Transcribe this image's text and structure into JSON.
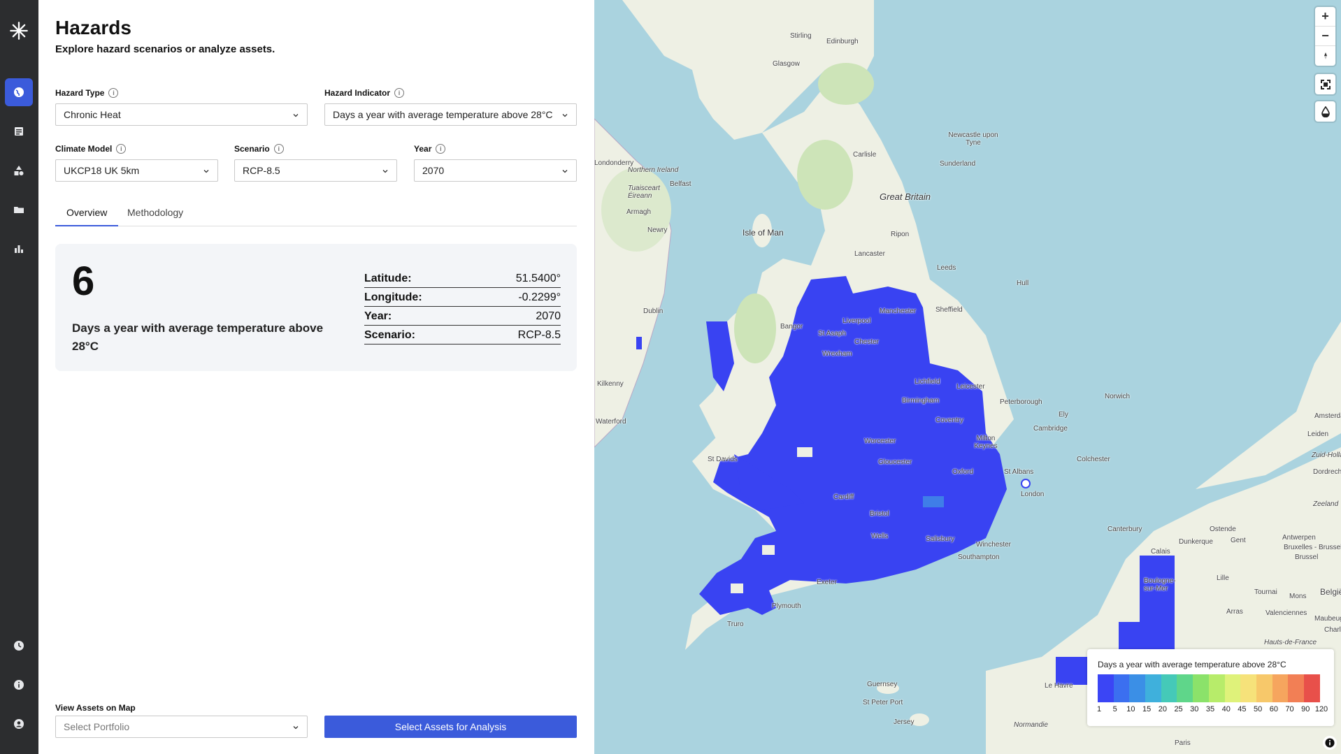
{
  "page": {
    "title": "Hazards",
    "subtitle": "Explore hazard scenarios or analyze assets."
  },
  "sidebar": {
    "items": [
      {
        "icon": "logo-icon"
      },
      {
        "icon": "globe-icon",
        "active": true
      },
      {
        "icon": "list-icon"
      },
      {
        "icon": "shapes-icon"
      },
      {
        "icon": "folder-icon"
      },
      {
        "icon": "bar-chart-icon"
      },
      {
        "icon": "clock-icon"
      },
      {
        "icon": "info-icon"
      },
      {
        "icon": "user-icon"
      }
    ]
  },
  "filters": {
    "hazard_type": {
      "label": "Hazard Type",
      "value": "Chronic Heat"
    },
    "hazard_indicator": {
      "label": "Hazard Indicator",
      "value": "Days a year with average temperature above 28°C"
    },
    "climate_model": {
      "label": "Climate Model",
      "value": "UKCP18 UK 5km"
    },
    "scenario": {
      "label": "Scenario",
      "value": "RCP-8.5"
    },
    "year": {
      "label": "Year",
      "value": "2070"
    }
  },
  "tabs": [
    {
      "label": "Overview",
      "active": true
    },
    {
      "label": "Methodology",
      "active": false
    }
  ],
  "overview": {
    "value": "6",
    "description": "Days a year with average temperature above 28°C",
    "details": [
      {
        "key": "Latitude:",
        "value": "51.5400°"
      },
      {
        "key": "Longitude:",
        "value": "-0.2299°"
      },
      {
        "key": "Year:",
        "value": "2070"
      },
      {
        "key": "Scenario:",
        "value": "RCP-8.5"
      }
    ]
  },
  "assets": {
    "label": "View Assets on Map",
    "placeholder": "Select Portfolio",
    "button": "Select Assets for Analysis"
  },
  "map": {
    "places": [
      "Stirling",
      "Edinburgh",
      "Glasgow",
      "Newcastle upon Tyne",
      "Carlisle",
      "Sunderland",
      "Great Britain",
      "Belfast",
      "Northern Ireland",
      "Tuaisceart Éireann",
      "Armagh",
      "Newry",
      "Isle of Man",
      "Ripon",
      "Lancaster",
      "Leeds",
      "Hull",
      "Manchester",
      "Sheffield",
      "Liverpool",
      "Bangor",
      "St Asaph",
      "Chester",
      "Wrexham",
      "Dublin",
      "Lichfield",
      "Leicester",
      "Birmingham",
      "Peterborough",
      "Norwich",
      "Ely",
      "Coventry",
      "Cambridge",
      "Worcester",
      "Milton Keynes",
      "Gloucester",
      "Oxford",
      "St Albans",
      "Colchester",
      "London",
      "St Davids",
      "Cardiff",
      "Bristol",
      "Wells",
      "Salisbury",
      "Winchester",
      "Canterbury",
      "Southampton",
      "Exeter",
      "Plymouth",
      "Truro",
      "Guernsey",
      "St Peter Port",
      "Jersey",
      "Normandie",
      "Paris",
      "Dunkerque",
      "Calais",
      "Ostende",
      "Gent",
      "Antwerpen",
      "Bruxelles - Brussel",
      "Brussel",
      "België / Belgique",
      "Lille",
      "Amsterdam",
      "Leiden",
      "Zuid-Holland",
      "Zeeland",
      "Kilkenny",
      "Waterford",
      "Londonderry",
      "Dordrecht",
      "Boulogne-sur-Mer",
      "Arras",
      "Tournai",
      "Mons",
      "Valenciennes",
      "Maubeuge",
      "Charleroi",
      "Hauts-de-France",
      "Le Havre"
    ],
    "controls": [
      "zoom-in-icon",
      "zoom-out-icon",
      "compass-icon",
      "fullscreen-icon",
      "drop-icon"
    ]
  },
  "legend": {
    "title": "Days a year with average temperature above 28°C",
    "colors": [
      "#3b45f5",
      "#3b6ff0",
      "#3b8fe6",
      "#3fb0dc",
      "#45c9b8",
      "#5fd68a",
      "#8be26a",
      "#b7ec6a",
      "#dff27a",
      "#f6e27a",
      "#f7c86a",
      "#f6a55e",
      "#f27f55",
      "#e8504a"
    ],
    "ticks": [
      "1",
      "5",
      "10",
      "15",
      "20",
      "25",
      "30",
      "35",
      "40",
      "45",
      "50",
      "60",
      "70",
      "90",
      "120"
    ]
  }
}
